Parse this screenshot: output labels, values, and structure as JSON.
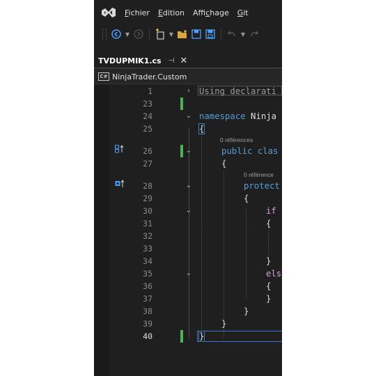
{
  "menu": {
    "items": [
      {
        "pre": "",
        "u": "F",
        "post": "ichier"
      },
      {
        "pre": "",
        "u": "E",
        "post": "dition"
      },
      {
        "pre": "Affi",
        "u": "c",
        "post": "hage"
      },
      {
        "pre": "",
        "u": "G",
        "post": "it"
      }
    ]
  },
  "tab": {
    "title": "TVDUPMIK1.cs",
    "pin": "⊣",
    "close": "✕"
  },
  "navbar": {
    "badge": "C#",
    "project": "NinjaTrader.Custom"
  },
  "editor": {
    "lines": [
      {
        "num": "1"
      },
      {
        "num": "23"
      },
      {
        "num": "24"
      },
      {
        "num": "25"
      },
      {
        "num": "26"
      },
      {
        "num": "27"
      },
      {
        "num": "28"
      },
      {
        "num": "29"
      },
      {
        "num": "30"
      },
      {
        "num": "31"
      },
      {
        "num": "32"
      },
      {
        "num": "33"
      },
      {
        "num": "34"
      },
      {
        "num": "35"
      },
      {
        "num": "36"
      },
      {
        "num": "37"
      },
      {
        "num": "38"
      },
      {
        "num": "39"
      },
      {
        "num": "40"
      }
    ],
    "code": {
      "using": "Using declarati",
      "ns_kw": "namespace",
      "ns_name": " Ninja",
      "open_brace": "{",
      "class_kw": "public clas",
      "protect": "protect",
      "if_kw": "if",
      "else_kw": "els",
      "close_brace": "}"
    },
    "hints": {
      "class_refs": "0 références",
      "method_refs": "0 référence"
    }
  }
}
